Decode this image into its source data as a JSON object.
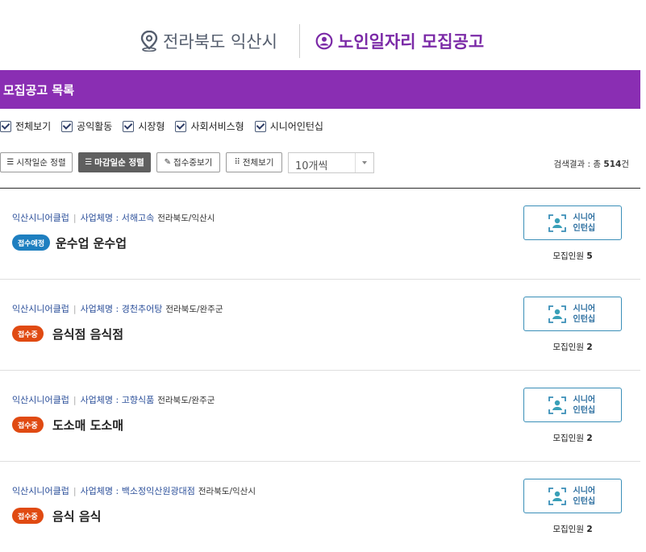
{
  "header": {
    "location": "전라북도 익산시",
    "title": "노인일자리 모집공고",
    "location_icon": "map-pin-icon",
    "title_icon": "user-circle-icon"
  },
  "section": {
    "title": "모집공고 목록"
  },
  "filters": [
    {
      "label": "전체보기",
      "checked": true
    },
    {
      "label": "공익활동",
      "checked": true
    },
    {
      "label": "시장형",
      "checked": true
    },
    {
      "label": "사회서비스형",
      "checked": true
    },
    {
      "label": "시니어인턴십",
      "checked": true
    }
  ],
  "toolbar": {
    "sort_start": "시작일순 정렬",
    "sort_deadline": "마감일순 정렬",
    "view_accepting": "접수중보기",
    "view_all": "전체보기",
    "per_page": "10개씩",
    "result_prefix": "검색결과 : 총 ",
    "result_count": "514",
    "result_suffix": "건"
  },
  "listings": [
    {
      "club": "익산시니어클럽",
      "company": "사업체명 : 서해고속",
      "region": "전라북도/익산시",
      "status": "접수예정",
      "title": "운수업 운수업",
      "type": "시니어\n인턴십",
      "recruit_label": "모집인원",
      "recruit_count": "5"
    },
    {
      "club": "익산시니어클럽",
      "company": "사업체명 : 경천추어탕",
      "region": "전라북도/완주군",
      "status": "접수중",
      "title": "음식점 음식점",
      "type": "시니어\n인턴십",
      "recruit_label": "모집인원",
      "recruit_count": "2"
    },
    {
      "club": "익산시니어클럽",
      "company": "사업체명 : 고향식품",
      "region": "전라북도/완주군",
      "status": "접수중",
      "title": "도소매 도소매",
      "type": "시니어\n인턴십",
      "recruit_label": "모집인원",
      "recruit_count": "2"
    },
    {
      "club": "익산시니어클럽",
      "company": "사업체명 : 백소정익산원광대점",
      "region": "전라북도/익산시",
      "status": "접수중",
      "title": "음식 음식",
      "type": "시니어\n인턴십",
      "recruit_label": "모집인원",
      "recruit_count": "2"
    }
  ],
  "colors": {
    "accent": "#8a2eb3",
    "status_upcoming": "#1e7fc0",
    "status_open": "#e04a12",
    "link": "#2b4f9a"
  }
}
